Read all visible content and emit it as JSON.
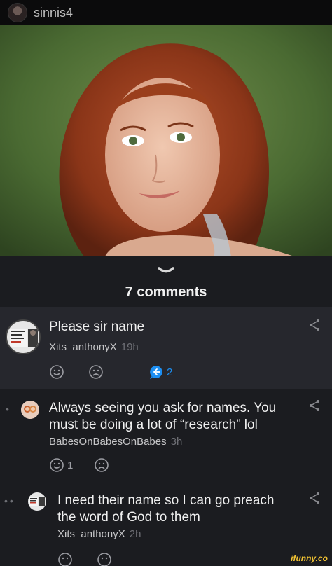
{
  "header": {
    "username": "sinnis4"
  },
  "comments_section": {
    "title": "7 comments"
  },
  "comments": [
    {
      "text": "Please sir name",
      "author": "Xits_anthonyX",
      "time": "19h",
      "reply_count": "2"
    },
    {
      "text_line1": "Always seeing you ask for names. You",
      "text_line2": "must be doing a lot of “research” lol",
      "author": "BabesOnBabesOnBabes",
      "time": "3h",
      "like_count": "1"
    },
    {
      "text_line1": "I need their name so I can go preach",
      "text_line2": "the word of God to them",
      "author": "Xits_anthonyX",
      "time": "2h"
    }
  ],
  "colors": {
    "reply_badge": "#1d8ff2",
    "time": "#6f7076",
    "watermark": "#f1c232"
  },
  "watermark": "ifunny.co"
}
